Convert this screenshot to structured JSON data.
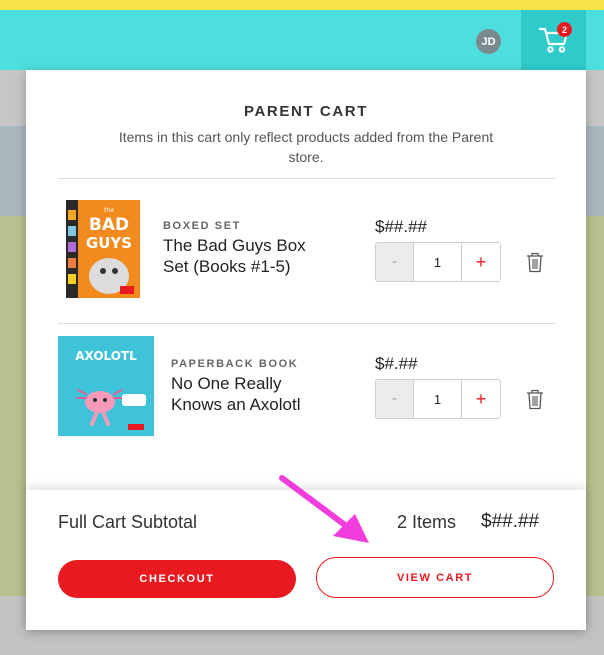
{
  "header": {
    "avatar_initials": "JD",
    "cart_count": "2",
    "accent_color": "#4ddfde",
    "badge_color": "#e8191f"
  },
  "cart": {
    "title": "PARENT CART",
    "subtitle": "Items in this cart only reflect products added from the Parent store.",
    "items": [
      {
        "category": "BOXED SET",
        "title_line1": "The Bad Guys Box",
        "title_line2": "Set (Books #1-5)",
        "price": "$##.##",
        "quantity": "1",
        "minus": "-",
        "plus": "+",
        "cover_text_top": "the",
        "cover_text_main1": "BAD",
        "cover_text_main2": "GUYS"
      },
      {
        "category": "PAPERBACK BOOK",
        "title_line1": "No One Really",
        "title_line2": "Knows an Axolotl",
        "price": "$#.##",
        "quantity": "1",
        "minus": "-",
        "plus": "+",
        "cover_text_main": "AXOLOTL"
      }
    ],
    "footer": {
      "subtotal_label": "Full Cart Subtotal",
      "items_count": "2 Items",
      "subtotal_value": "$##.##",
      "checkout_label": "CHECKOUT",
      "view_cart_label": "VIEW CART"
    }
  },
  "icons": [
    "cart-icon",
    "trash-icon",
    "annotation-arrow-icon"
  ]
}
